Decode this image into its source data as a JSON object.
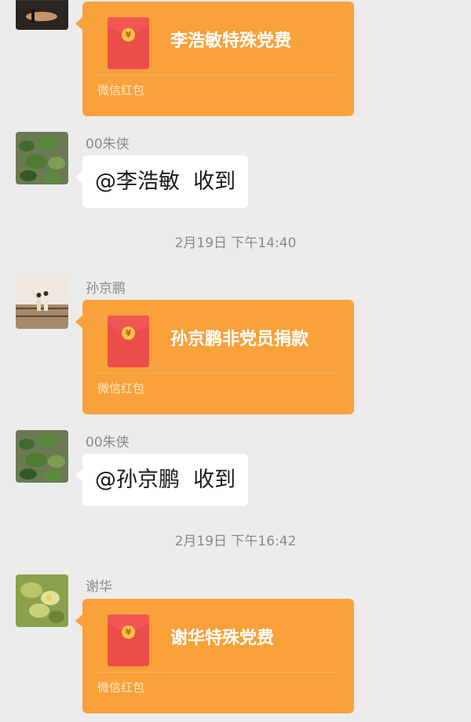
{
  "messages": [
    {
      "type": "red_packet",
      "title": "李浩敏特殊党费",
      "footer": "微信红包",
      "coin": "¥"
    },
    {
      "type": "text",
      "sender": "00朱侠",
      "text": "@李浩敏  收到"
    },
    {
      "type": "timestamp",
      "text": "2月19日 下午14:40"
    },
    {
      "type": "red_packet",
      "sender": "孙京鹏",
      "title": "孙京鹏非党员捐款",
      "footer": "微信红包",
      "coin": "¥"
    },
    {
      "type": "text",
      "sender": "00朱侠",
      "text": "@孙京鹏  收到"
    },
    {
      "type": "timestamp",
      "text": "2月19日 下午16:42"
    },
    {
      "type": "red_packet",
      "sender": "谢华",
      "title": "谢华特殊党费",
      "footer": "微信红包",
      "coin": "¥"
    }
  ],
  "colors": {
    "background": "#ececec",
    "packet": "#f9a13b",
    "envelope": "#ec4d4a",
    "coin": "#f7c842",
    "bubble": "#ffffff"
  }
}
